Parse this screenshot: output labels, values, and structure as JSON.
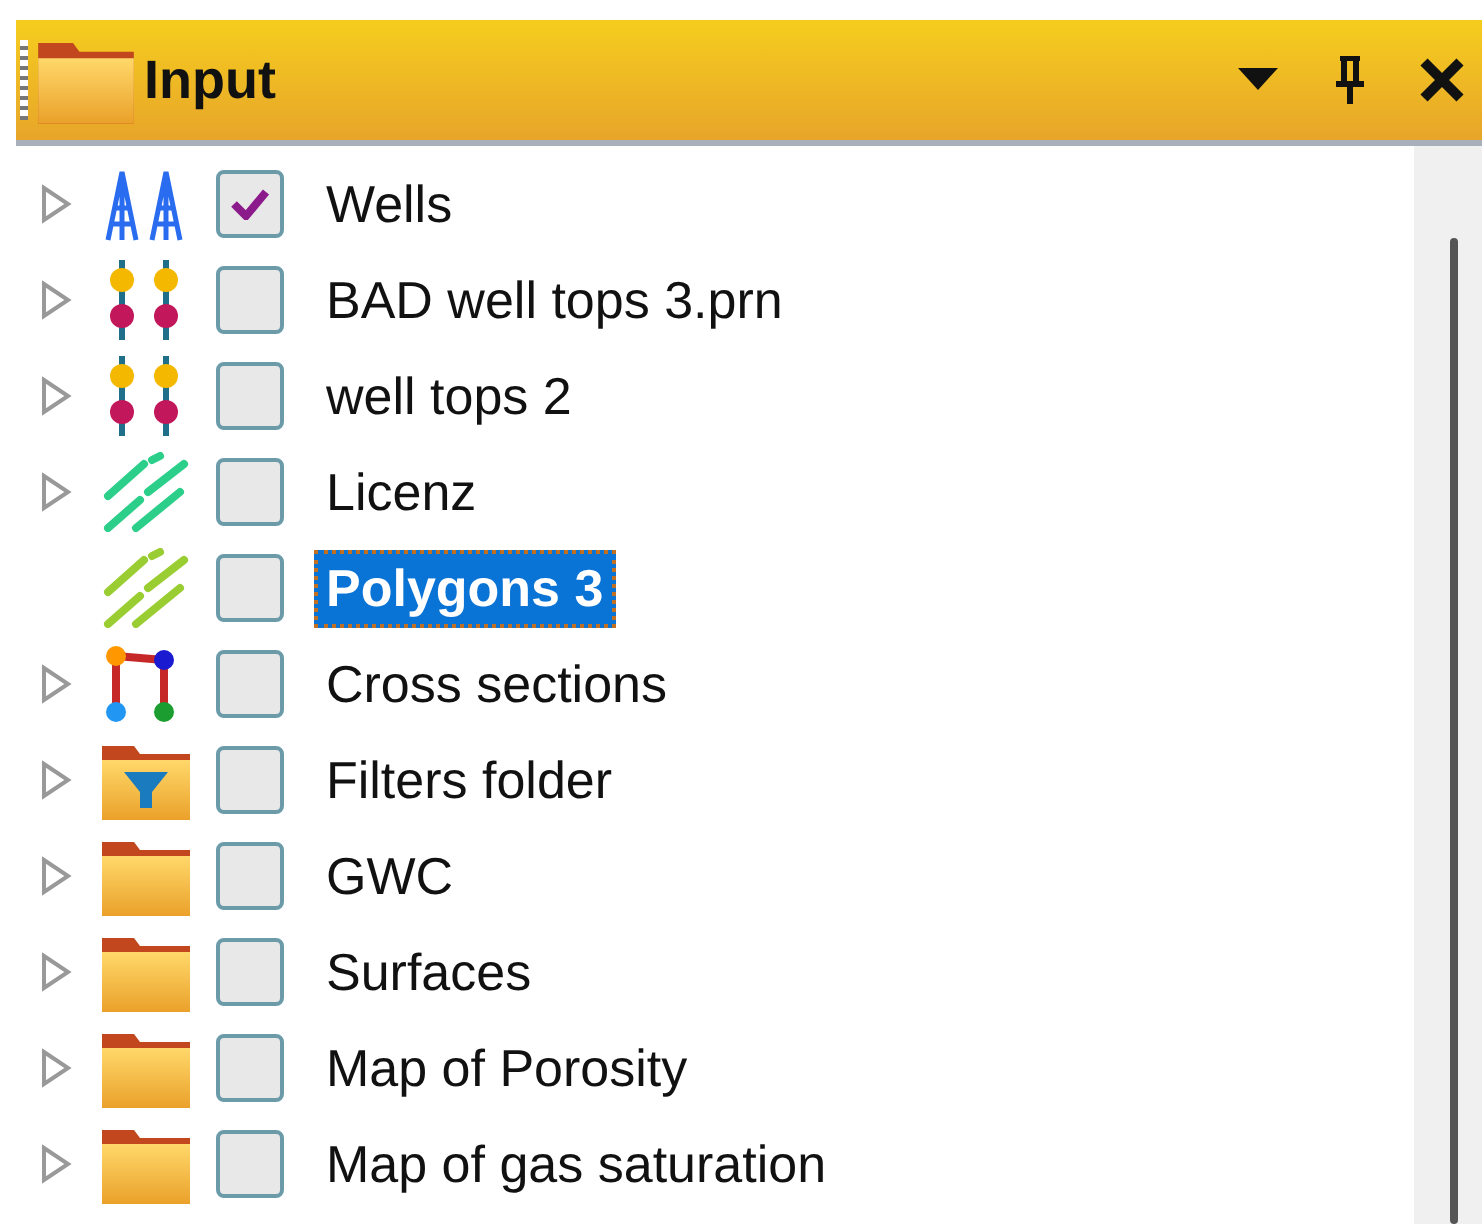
{
  "panel": {
    "title": "Input"
  },
  "items": [
    {
      "label": "Wells",
      "kind": "wells",
      "expandable": true,
      "checked": true,
      "selected": false
    },
    {
      "label": "BAD well tops 3.prn",
      "kind": "tops",
      "expandable": true,
      "checked": false,
      "selected": false
    },
    {
      "label": "well tops 2",
      "kind": "tops",
      "expandable": true,
      "checked": false,
      "selected": false
    },
    {
      "label": "Licenz",
      "kind": "polygons",
      "color": "#2bcf8a",
      "expandable": true,
      "checked": false,
      "selected": false
    },
    {
      "label": "Polygons 3",
      "kind": "polygons",
      "color": "#9acd32",
      "expandable": false,
      "checked": false,
      "selected": true
    },
    {
      "label": "Cross sections",
      "kind": "cross",
      "expandable": true,
      "checked": false,
      "selected": false
    },
    {
      "label": "Filters folder",
      "kind": "filter-folder",
      "expandable": true,
      "checked": false,
      "selected": false
    },
    {
      "label": "GWC",
      "kind": "folder",
      "expandable": true,
      "checked": false,
      "selected": false
    },
    {
      "label": "Surfaces",
      "kind": "folder",
      "expandable": true,
      "checked": false,
      "selected": false
    },
    {
      "label": "Map of Porosity",
      "kind": "folder",
      "expandable": true,
      "checked": false,
      "selected": false
    },
    {
      "label": "Map of gas saturation",
      "kind": "folder",
      "expandable": true,
      "checked": false,
      "selected": false
    }
  ]
}
